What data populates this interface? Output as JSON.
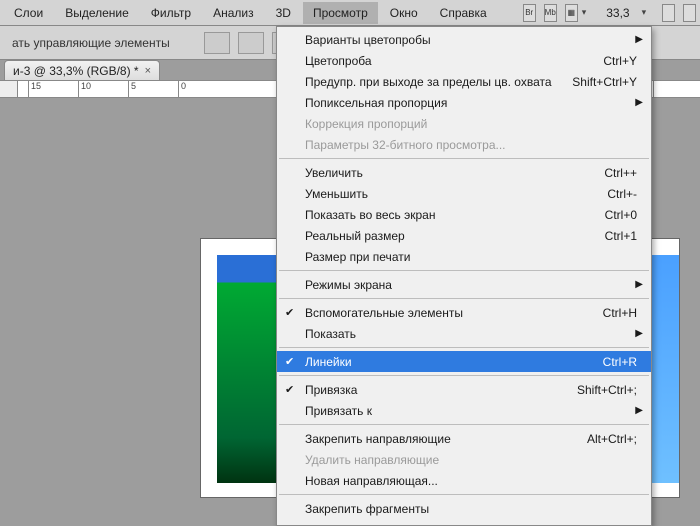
{
  "menubar": {
    "items": [
      "Слои",
      "Выделение",
      "Фильтр",
      "Анализ",
      "3D",
      "Просмотр",
      "Окно",
      "Справка"
    ],
    "active_index": 5,
    "icons": [
      "Br",
      "Mb",
      "▦"
    ],
    "zoom": "33,3"
  },
  "toolbar": {
    "label": "ать управляющие элементы"
  },
  "doc_tab": {
    "title": "и-3 @ 33,3% (RGB/8) *"
  },
  "ruler": {
    "marks": [
      "15",
      "10",
      "5",
      "0"
    ]
  },
  "menu": {
    "groups": [
      [
        {
          "label": "Варианты цветопробы",
          "sub": true
        },
        {
          "label": "Цветопроба",
          "shortcut": "Ctrl+Y"
        },
        {
          "label": "Предупр. при выходе за пределы цв. охвата",
          "shortcut": "Shift+Ctrl+Y"
        },
        {
          "label": "Попиксельная пропорция",
          "sub": true
        },
        {
          "label": "Коррекция пропорций",
          "disabled": true
        },
        {
          "label": "Параметры 32-битного просмотра...",
          "disabled": true
        }
      ],
      [
        {
          "label": "Увеличить",
          "shortcut": "Ctrl++"
        },
        {
          "label": "Уменьшить",
          "shortcut": "Ctrl+-"
        },
        {
          "label": "Показать во весь экран",
          "shortcut": "Ctrl+0"
        },
        {
          "label": "Реальный размер",
          "shortcut": "Ctrl+1"
        },
        {
          "label": "Размер при печати"
        }
      ],
      [
        {
          "label": "Режимы экрана",
          "sub": true
        }
      ],
      [
        {
          "label": "Вспомогательные элементы",
          "shortcut": "Ctrl+H",
          "checked": true
        },
        {
          "label": "Показать",
          "sub": true
        }
      ],
      [
        {
          "label": "Линейки",
          "shortcut": "Ctrl+R",
          "checked": true,
          "highlight": true
        }
      ],
      [
        {
          "label": "Привязка",
          "shortcut": "Shift+Ctrl+;",
          "checked": true
        },
        {
          "label": "Привязать к",
          "sub": true
        }
      ],
      [
        {
          "label": "Закрепить направляющие",
          "shortcut": "Alt+Ctrl+;"
        },
        {
          "label": "Удалить направляющие",
          "disabled": true
        },
        {
          "label": "Новая направляющая..."
        }
      ],
      [
        {
          "label": "Закрепить фрагменты"
        }
      ]
    ]
  }
}
